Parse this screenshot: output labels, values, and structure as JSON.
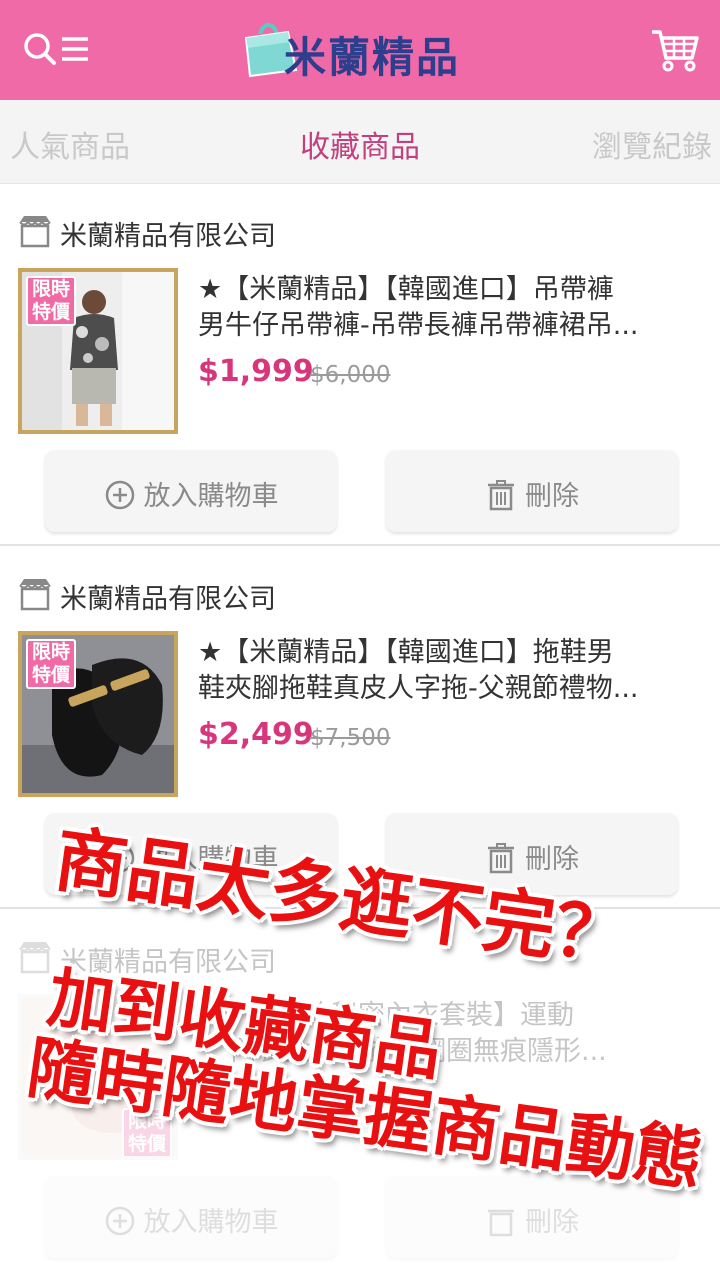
{
  "header": {
    "logo_text": "米蘭精品",
    "menu_icon": "search-menu-icon",
    "cart_icon": "cart-icon",
    "brand_color": "#f16aa8"
  },
  "tabs": [
    {
      "label": "人氣商品",
      "active": false
    },
    {
      "label": "收藏商品",
      "active": true
    },
    {
      "label": "瀏覽紀錄",
      "active": false
    }
  ],
  "favorites": [
    {
      "store": "米蘭精品有限公司",
      "badge": "限時特價",
      "title_line1": "★【米蘭精品】【韓國進口】吊帶褲",
      "title_line2": "男牛仔吊帶褲-吊帶長褲吊帶褲裙吊...",
      "price": "$1,999",
      "old_price": "$6,000",
      "add_to_cart_label": "放入購物車",
      "delete_label": "刪除"
    },
    {
      "store": "米蘭精品有限公司",
      "badge": "限時特價",
      "title_line1": "★【米蘭精品】【韓國進口】拖鞋男",
      "title_line2": "鞋夾腳拖鞋真皮人字拖-父親節禮物...",
      "price": "$2,499",
      "old_price": "$7,500",
      "add_to_cart_label": "放入購物車",
      "delete_label": "刪除"
    },
    {
      "store": "米蘭精品有限公司",
      "badge": "限時特價",
      "title_line1": "甜美的秘密內衣套裝】運動",
      "title_line2": "內衣女裝內衣無鋼圈無痕隱形...",
      "price": "",
      "old_price": "",
      "add_to_cart_label": "放入購物車",
      "delete_label": "刪除"
    }
  ],
  "promo": {
    "line1": "商品太多逛不完？",
    "line2": "加到收藏商品",
    "line3": "隨時隨地掌握商品動態",
    "color": "#e81010"
  }
}
